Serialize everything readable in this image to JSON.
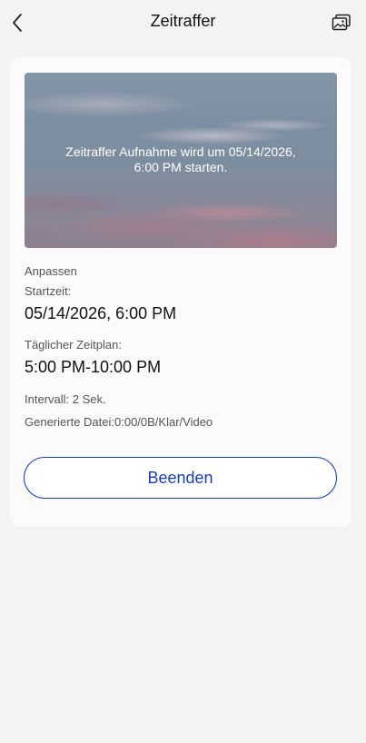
{
  "header": {
    "title": "Zeitraffer",
    "back_icon": "chevron-left-icon",
    "gallery_icon": "gallery-icon"
  },
  "preview": {
    "message": "Zeitraffer Aufnahme wird um 05/14/2026, 6:00 PM starten."
  },
  "details": {
    "customize_label": "Anpassen",
    "start_label": "Startzeit:",
    "start_value": "05/14/2026, 6:00 PM",
    "schedule_label": "Täglicher Zeitplan:",
    "schedule_value": "5:00 PM-10:00 PM",
    "interval": "Intervall: 2 Sek.",
    "generated_file": "Generierte Datei:0:00/0B/Klar/Video"
  },
  "actions": {
    "stop_label": "Beenden"
  },
  "colors": {
    "accent": "#1a3eb0",
    "background": "#f2f3f5",
    "card": "#fbfbfc"
  }
}
